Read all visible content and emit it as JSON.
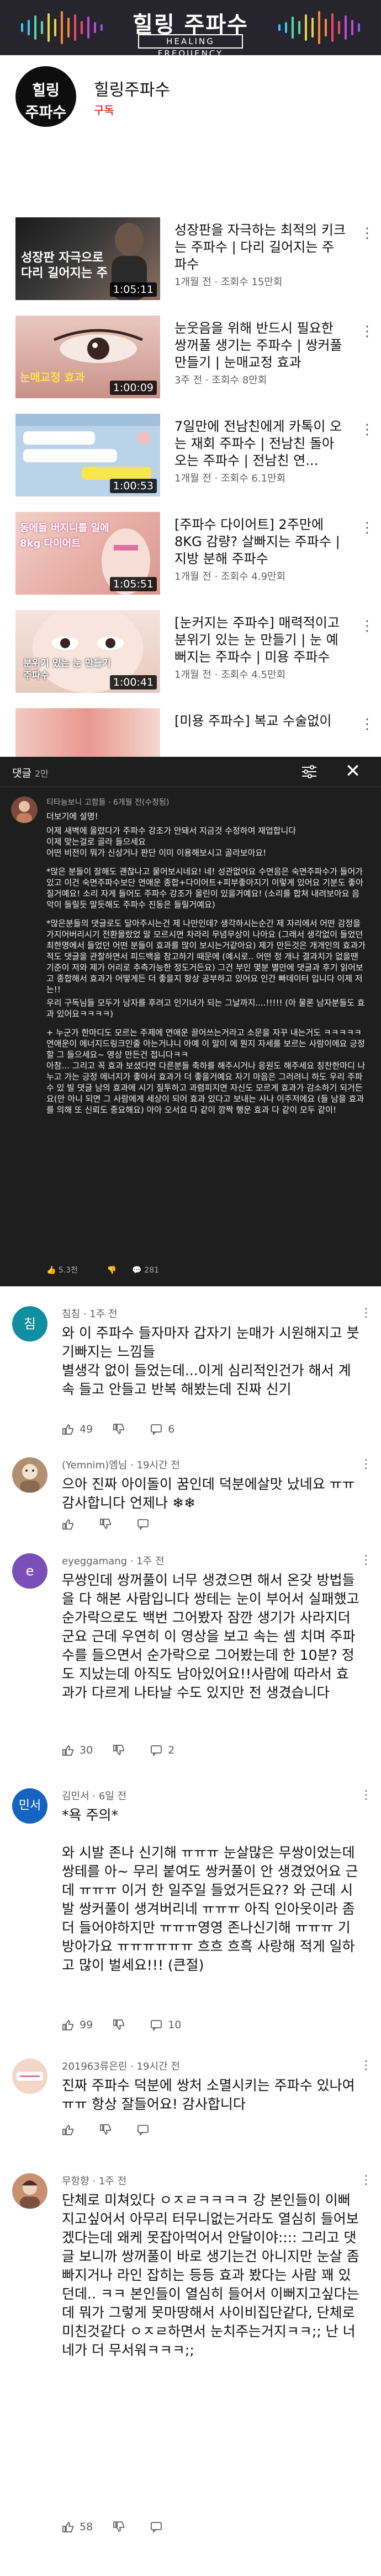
{
  "banner": {
    "title": "힐링 주파수",
    "subtitle": "HEALING FREQUENCY"
  },
  "channel": {
    "avatar_line1": "힐링",
    "avatar_line2": "주파수",
    "name": "힐링주파수",
    "subscribe_label": "구독"
  },
  "videos": [
    {
      "title": "성장판을 자극하는 최적의 키크는 주파수 | 다리 길어지는 주파수",
      "meta": "1개월 전 · 조회수 15만회",
      "duration": "1:05:11",
      "thumb_caption": "성장판 자극으로\n다리 길어지는 주"
    },
    {
      "title": "눈웃음을 위해 반드시 필요한 쌍꺼풀 생기는 주파수 | 쌍커풀 만들기 | 눈매교정 효과",
      "meta": "3주 전 · 조회수 8만회",
      "duration": "1:00:09",
      "thumb_caption": "눈매교정 효과"
    },
    {
      "title": "7일만에 전남친에게 카톡이 오는 재회 주파수 | 전남친 돌아오는 주파수 | 전남친 연...",
      "meta": "1개월 전 · 조회수 6.1만회",
      "duration": "1:00:53",
      "thumb_caption": ""
    },
    {
      "title": "[주파수 다이어트] 2주만에 8KG 감량? 살빠지는 주파수 | 지방 분해 주파수",
      "meta": "1개월 전 · 조회수 4.9만회",
      "duration": "1:05:51",
      "thumb_caption": "동에들 버지니를 일에 8kg 다이어트"
    },
    {
      "title": "[눈커지는 주파수] 매력적이고 분위기 있는 눈 만들기 | 눈 예뻐지는 주파수 | 미용 주파수",
      "meta": "1개월 전 · 조회수 4.5만회",
      "duration": "1:00:41",
      "thumb_caption": "분위기 있는 눈 만들기\n주파수"
    },
    {
      "title": "[미용 주파수] 복교 수술없이",
      "meta": "",
      "duration": "",
      "thumb_caption": ""
    }
  ],
  "comments_panel": {
    "title": "댓글",
    "count": "2만",
    "pinned": {
      "author": "티타늄보니 고함들 · 6개월 전(수정됨)",
      "paragraphs": [
        "더보기에 설명!",
        "어제 새벽에 올렸다가 주파수 강조가 안돼서 지금것 수정하여 재업합니다\n이제 맞는걸로 골라 들으세요\n어떤 비전이 뭐가 신상거나 판단 이미 이용해보시고 골라보아요!",
        "*많은 분들이 잘해도 괜찮나고 물어보시네요! 네! 성관없어요 수면음은 숙면주파수가 들어가있고 이건 숙면주파수보단 연애운 종합+다이어트+피부좋아지기 이렇게 있어요 기분도 좋아질거예요! 소리 자게 들어도 주파수 강조가 올린이 있을거예요! (소리를 합쳐 내려보아요 음악이 들릴듯 말듯해도 주파수 진동은 들릴거예요)",
        "*많은분들의 댓글로도 달아주시는건 제 나만인데? 생각하시는순간 제 자리에서 어떤 감정을 가지어버리시기 전환몰랐었 말 모르시면 차라리 무념무상이 나아요 (그래서 생각없이 들었던 최한명에서 들었던 어떤 분들이 효과를 많이 보시는거같아요) 제가 만든것은 개개인의 효과가 적도 댓글을 관찰하면서 피드백을 참고하기 때문에 (예시로.. 어떤 정 개나 결과치가 없을땐 기준이 저와 제가 어리로 추측가능한 정도거든요) 그건 부인 몇분 별만에 댓글과 후기 읽어보고 종합해서 효과가 어떻게든 더 좋을지 항상 공부하고 있어요 인간 빠데이터 입니다 이제 저는!!",
        "우리 구독님들 모두가 남자를 후려고 인기녀가 되는 그날까지....!!!!! (아 물론 남자분들도 효과 있어요ㅋㅋㅋㅋ)",
        "+ 누군가 한마디도 모르는 주제에 연애운 끌어쓰는거라고 소문을 자꾸 내는거도 ㅋㅋㅋㅋㅋ 연애운이 에너지드링크인줄 아는거냐니 아예 이 말이 에 뭔지 자세를 보르는 사람이에요 긍정할 그 들으세요~ 영상 만든건 접니다ㅋㅋ\n아참... 그리고 꼭 효과 보셨다면 다른분들 축하를 해주시거나 응원도 해주세요 칭찬한마디 나누고 가는 긍정 에너지가 좋아서 효과가 더 좋을거예요 자기 마음은 그러려니 하도 우리 주파수 있 빌 댓글 남의 효과에 시기 질투하고 과렴피지면 자신도 모르게 효과가 감소하기 되거든요(만 아니 되면 그 사람에게 세상이 되어 효과 있다고 보내는 사나 이주저에요 (들 남을 효과를 의해 또 신뢰도 중요해요) 아아 오서요 다 같이 깜짝 행운 효과 다 같이 모두 같이!"
      ],
      "likes": "5.3천",
      "replies": "281"
    }
  },
  "comments": [
    {
      "avatar_text": "침",
      "avatar_color": "#0f8f9f",
      "author": "침침 · 1주 전",
      "body": "와 이 주파수 들자마자 갑자기 눈매가 시원해지고 붓기빠지는 느낌들\n별생각 없이 들었는데...이게 심리적인건가 해서 계속 들고 안들고 반복 해봤는데 진짜 신기",
      "likes": "49",
      "replies": "6"
    },
    {
      "avatar_text": "",
      "avatar_color": "#b09070",
      "author": "(Yemnim)엠님 · 19시간 전",
      "body": "으아 진짜 아이돌이 꿈인데 덕분에살맛 났네요 ㅠㅠ 감사합니다 언제나 ❄❄",
      "likes": "",
      "replies": ""
    },
    {
      "avatar_text": "e",
      "avatar_color": "#7b4fb8",
      "author": "eyeggamang · 1주 전",
      "body": "무쌍인데 쌍꺼풀이 너무 생겼으면 해서 온갖 방법들을 다 해본 사람입니다\n쌍테는 눈이 부어서 실패했고 순가락으로도 백번 그어봤자 잠깐 생기가 사라지더군요 근데 우연히 이 영상을 보고 속는 셈 치며 주파수를 들으면서 순가락으로 그어봤는데 한 10분? 정도 지났는데 아직도 남아있어요!!사람에 따라서 효과가 다르게 나타날 수도 있지만 전 생겼습니다",
      "likes": "30",
      "replies": "2"
    },
    {
      "avatar_text": "민서",
      "avatar_color": "#1565c0",
      "author": "김민서 · 6일 전",
      "body": "*욕 주의*\n\n와 시발 존나 신기해 ㅠㅠㅠ 눈살많은 무쌍이었는데 쌍테를 아~ 무리 붙여도 쌍커풀이 안 생겼었어요 근데 ㅠㅠㅠ 이거 한 일주일 들었거든요?? 와 근데 시발 쌍커풀이 생겨버리네 ㅠㅠㅠ 아직 인아웃이라 좀더 들어야하지만 ㅠㅠㅠ영영 존나신기해 ㅠㅠㅠ 기방아가요 ㅠㅠㅠㅠㅠㅠ 흐흐 흐흑 사랑해 적게 일하고 많이 벌세요!!! (큰절)",
      "likes": "99",
      "replies": "10"
    },
    {
      "avatar_text": "",
      "avatar_color": "#f2d6c8",
      "author": "201963류은린 · 19시간 전",
      "body": "진짜 주파수 덕분에 쌍처 소멸시키는 주파수 있나여ㅠㅠ 항상 잘들어요! 감사합니다",
      "likes": "",
      "replies": ""
    },
    {
      "avatar_text": "",
      "avatar_color": "#c89070",
      "author": "무항향 · 1주 전",
      "body": "단체로 미쳐있다 ㅇㅈㄹㅋㅋㅋㅋ 강 본인들이 이뻐지고싶어서 아무리 터무니없는거라도 열심히 들어보겠다는데 왜케 못잡아먹어서 안달이야:::: 그리고 댓글 보니까 쌍꺼풀이 바로 생기는건 아니지만 눈살 좀 빠지거나 라인 잡히는 등등 효과 봤다는 사람 꽤 있던데.. ㅋㅋ 본인들이 열심히 들어서 이뻐지고싶다는데 뭐가 그렇게 못마땅해서 사이비집단같다, 단체로 미친것같다 ㅇㅈㄹ하면서 눈치주는거지ㅋㅋ;; 난 너네가 더 무서워ㅋㅋㅋ;;",
      "likes": "58",
      "replies": ""
    }
  ]
}
